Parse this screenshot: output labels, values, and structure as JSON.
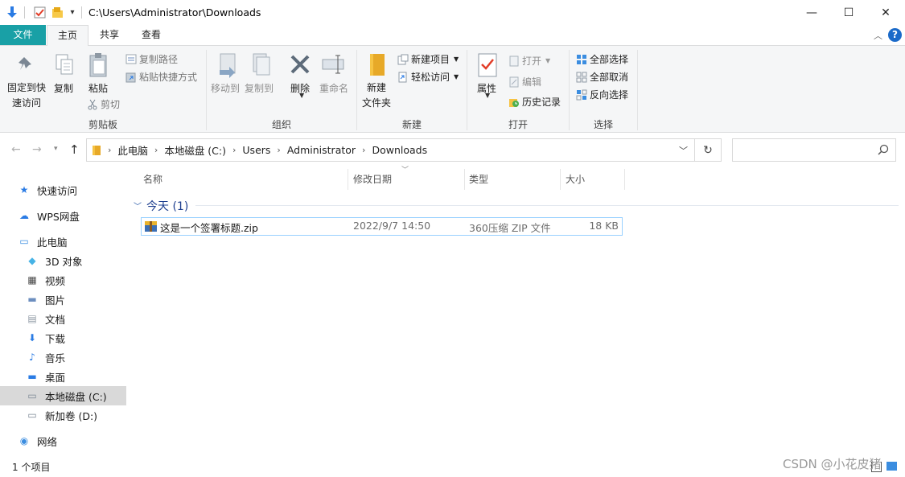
{
  "window": {
    "title_path": "C:\\Users\\Administrator\\Downloads",
    "minimize": "—",
    "maximize": "☐",
    "close": "✕"
  },
  "ribbon_tabs": [
    "文件",
    "主页",
    "共享",
    "查看"
  ],
  "ribbon": {
    "clipboard": {
      "pin_line1": "固定到快",
      "pin_line2": "速访问",
      "copy": "复制",
      "paste": "粘贴",
      "copy_path": "复制路径",
      "paste_shortcut": "粘贴快捷方式",
      "cut": "剪切",
      "group": "剪贴板"
    },
    "organize": {
      "move_to": "移动到",
      "copy_to": "复制到",
      "delete": "删除",
      "rename": "重命名",
      "group": "组织"
    },
    "new": {
      "new_folder_line1": "新建",
      "new_folder_line2": "文件夹",
      "new_item": "新建项目",
      "easy_access": "轻松访问",
      "group": "新建"
    },
    "open": {
      "properties": "属性",
      "open": "打开",
      "edit": "编辑",
      "history": "历史记录",
      "group": "打开"
    },
    "select": {
      "select_all": "全部选择",
      "select_none": "全部取消",
      "invert": "反向选择",
      "group": "选择"
    }
  },
  "breadcrumb": [
    "此电脑",
    "本地磁盘 (C:)",
    "Users",
    "Administrator",
    "Downloads"
  ],
  "nav_pane": [
    {
      "label": "快速访问",
      "icon": "star-icon"
    },
    {
      "label": "WPS网盘",
      "icon": "cloud-icon"
    },
    {
      "label": "此电脑",
      "icon": "computer-icon"
    },
    {
      "label": "3D 对象",
      "icon": "cube-icon"
    },
    {
      "label": "视频",
      "icon": "video-icon"
    },
    {
      "label": "图片",
      "icon": "picture-icon"
    },
    {
      "label": "文档",
      "icon": "document-icon"
    },
    {
      "label": "下载",
      "icon": "download-icon"
    },
    {
      "label": "音乐",
      "icon": "music-icon"
    },
    {
      "label": "桌面",
      "icon": "desktop-icon"
    },
    {
      "label": "本地磁盘 (C:)",
      "icon": "drive-icon"
    },
    {
      "label": "新加卷 (D:)",
      "icon": "drive-icon"
    },
    {
      "label": "网络",
      "icon": "network-icon"
    }
  ],
  "columns": [
    "名称",
    "修改日期",
    "类型",
    "大小"
  ],
  "group_header": "今天 (1)",
  "files": [
    {
      "name": "这是一个签署标题.zip",
      "modified": "2022/9/7 14:50",
      "type": "360压缩 ZIP 文件",
      "size": "18 KB"
    }
  ],
  "status": "1 个项目",
  "watermark": "CSDN @小花皮猪",
  "colors": {
    "file_tab": "#19a0a6",
    "selection_border": "#99d1ff",
    "selection_bg": "#ffffff",
    "nav_selected": "#d9d9d9"
  }
}
